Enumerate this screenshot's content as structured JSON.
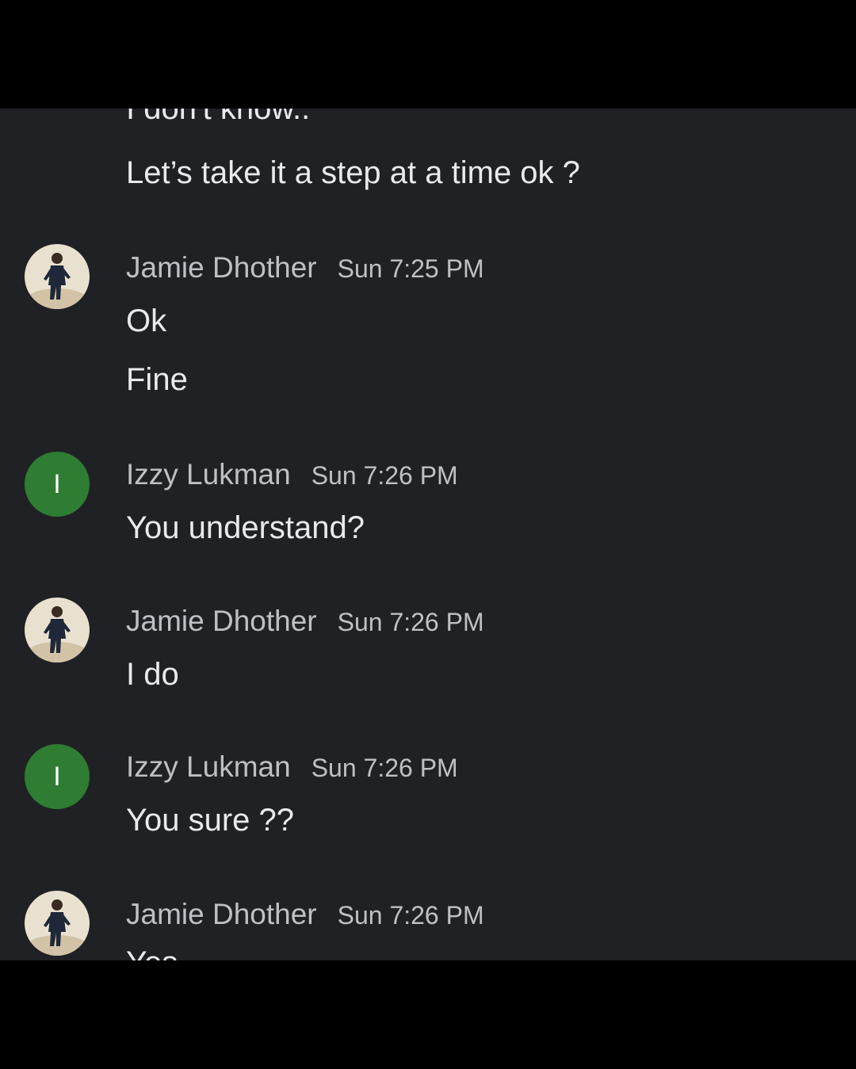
{
  "messages": {
    "prev_line_1": "I don't know..",
    "prev_line_2": "Let’s take it a step at a time ok ?",
    "m1": {
      "sender": "Jamie Dhother",
      "time": "Sun 7:25 PM",
      "lines": [
        "Ok",
        "Fine"
      ]
    },
    "m2": {
      "sender": "Izzy Lukman",
      "initial": "I",
      "time": "Sun 7:26 PM",
      "lines": [
        "You understand?"
      ]
    },
    "m3": {
      "sender": "Jamie Dhother",
      "time": "Sun 7:26 PM",
      "lines": [
        "I do"
      ]
    },
    "m4": {
      "sender": "Izzy Lukman",
      "initial": "I",
      "time": "Sun 7:26 PM",
      "lines": [
        "You sure ??"
      ]
    },
    "m5": {
      "sender": "Jamie Dhother",
      "time": "Sun 7:26 PM",
      "lines": [
        "Yes"
      ]
    }
  },
  "colors": {
    "background": "#202124",
    "text": "#e8eaed",
    "meta_text": "#bdc1c6",
    "izzy_avatar": "#2e7d32"
  },
  "icons": {
    "jamie_avatar": "person-photo-avatar",
    "izzy_avatar": "letter-avatar"
  }
}
